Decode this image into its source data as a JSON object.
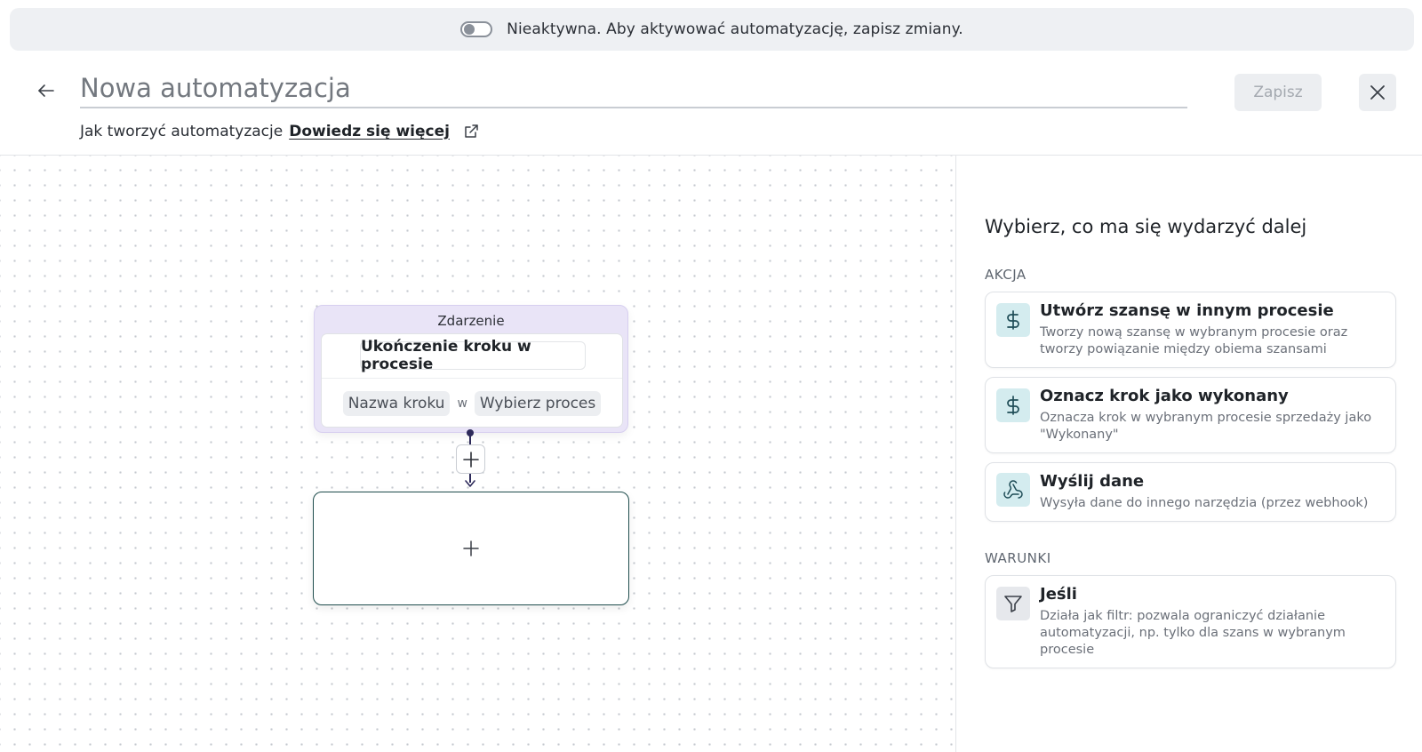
{
  "banner": {
    "toggle_state": "off",
    "text": "Nieaktywna. Aby aktywować automatyzację, zapisz zmiany."
  },
  "header": {
    "title_placeholder": "Nowa automatyzacja",
    "save_label": "Zapisz",
    "help_text": "Jak tworzyć automatyzacje",
    "help_link": "Dowiedz się więcej",
    "icons": [
      "arrow-left-icon",
      "close-icon",
      "external-link-icon"
    ]
  },
  "canvas": {
    "event_node": {
      "label": "Zdarzenie",
      "title": "Ukończenie kroku w procesie",
      "param_step": "Nazwa kroku",
      "param_joiner": "w",
      "param_process": "Wybierz proces"
    },
    "icons": [
      "plus-icon",
      "arrow-down-icon"
    ]
  },
  "panel": {
    "title": "Wybierz, co ma się wydarzyć dalej",
    "sections": [
      {
        "label": "AKCJA",
        "options": [
          {
            "icon": "dollar-icon",
            "title": "Utwórz szansę w innym procesie",
            "description": "Tworzy nową szansę w wybranym procesie oraz tworzy powiązanie między obiema szansami"
          },
          {
            "icon": "dollar-icon",
            "title": "Oznacz krok jako wykonany",
            "description": "Oznacza krok w wybranym procesie sprzedaży jako \"Wykonany\""
          },
          {
            "icon": "webhook-icon",
            "title": "Wyślij dane",
            "description": "Wysyła dane do innego narzędzia (przez webhook)"
          }
        ]
      },
      {
        "label": "WARUNKI",
        "options": [
          {
            "icon": "filter-icon",
            "title": "Jeśli",
            "description": "Działa jak filtr: pozwala ograniczyć działanie automatyzacji, np. tylko dla szans w wybranym procesie"
          }
        ]
      }
    ]
  },
  "colors": {
    "event_node_bg": "#e9e4f7",
    "connector": "#2d2a5a",
    "empty_node_border": "#1f4d4d",
    "action_icon_bg": "#d4ecef",
    "condition_icon_bg": "#e6e8ec"
  }
}
